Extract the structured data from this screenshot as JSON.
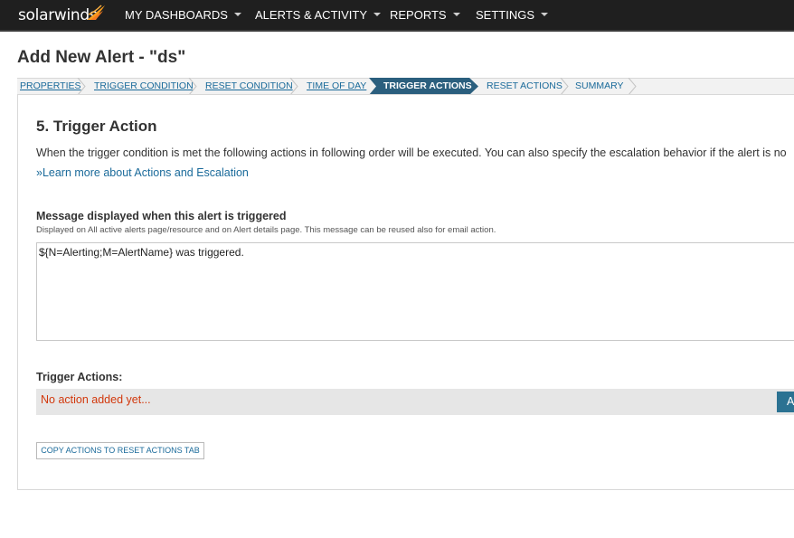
{
  "app": {
    "logo_text": "solarwinds",
    "nav": [
      {
        "label": "MY DASHBOARDS"
      },
      {
        "label": "ALERTS & ACTIVITY"
      },
      {
        "label": "REPORTS"
      },
      {
        "label": "SETTINGS"
      }
    ]
  },
  "page": {
    "title": "Add New Alert - \"ds\""
  },
  "wizard": {
    "steps": [
      {
        "label": "PROPERTIES",
        "state": "completed"
      },
      {
        "label": "TRIGGER CONDITION",
        "state": "completed"
      },
      {
        "label": "RESET CONDITION",
        "state": "completed"
      },
      {
        "label": "TIME OF DAY",
        "state": "completed"
      },
      {
        "label": "TRIGGER ACTIONS",
        "state": "active"
      },
      {
        "label": "RESET ACTIONS",
        "state": "pending"
      },
      {
        "label": "SUMMARY",
        "state": "pending"
      }
    ]
  },
  "section": {
    "title": "5. Trigger Action",
    "description": "When the trigger condition is met the following actions in following order will be executed. You can also specify the escalation behavior if the alert is no",
    "learn_more": "»Learn more about Actions and Escalation"
  },
  "message": {
    "label": "Message displayed when this alert is triggered",
    "help": "Displayed on All active alerts page/resource and on Alert details page. This message can be reused also for email action.",
    "value": "${N=Alerting;M=AlertName} was triggered."
  },
  "trigger_actions": {
    "label": "Trigger Actions:",
    "empty_text": "No action added yet...",
    "add_button": "A"
  },
  "copy_button": "COPY ACTIONS TO RESET ACTIONS TAB",
  "colors": {
    "topbar": "#1f1f1f",
    "accent_link": "#1a6a9a",
    "active_step": "#2b5f7e",
    "empty_text": "#d2380c",
    "add_button": "#2b7292"
  }
}
